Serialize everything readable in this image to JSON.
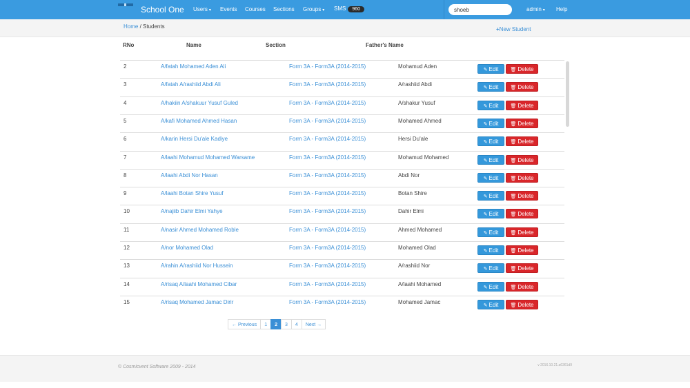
{
  "navbar": {
    "brand": "School One",
    "items": [
      {
        "label": "Users",
        "caret": true
      },
      {
        "label": "Events",
        "caret": false
      },
      {
        "label": "Courses",
        "caret": false
      },
      {
        "label": "Sections",
        "caret": false
      },
      {
        "label": "Groups",
        "caret": true
      },
      {
        "label": "SMS",
        "caret": false
      }
    ],
    "sms_count": "960",
    "search_value": "shoeb",
    "admin_label": "admin",
    "help_label": "Help",
    "caret_glyph": "▾"
  },
  "breadcrumb": {
    "home": "Home",
    "separator": " / ",
    "current": "Students"
  },
  "new_student_label": "New Student",
  "table": {
    "headers": {
      "rno": "RNo",
      "name": "Name",
      "section": "Section",
      "father": "Father's Name"
    },
    "edit_label": "Edit",
    "delete_label": "Delete",
    "rows": [
      {
        "rno": "2",
        "name": "A/fatah Mohamed Aden Ali",
        "section": "Form 3A - Form3A (2014-2015)",
        "father": "Mohamud Aden"
      },
      {
        "rno": "3",
        "name": "A/fatah A/rashiid Abdi Ali",
        "section": "Form 3A - Form3A (2014-2015)",
        "father": "A/rashiid Abdi"
      },
      {
        "rno": "4",
        "name": "A/hakiin A/shakuur Yusuf Guled",
        "section": "Form 3A - Form3A (2014-2015)",
        "father": "A/shakur Yusuf"
      },
      {
        "rno": "5",
        "name": "A/kafi Mohamed Ahmed Hasan",
        "section": "Form 3A - Form3A (2014-2015)",
        "father": "Mohamed Ahmed"
      },
      {
        "rno": "6",
        "name": "A/karin Hersi Du'ale Kadiye",
        "section": "Form 3A - Form3A (2014-2015)",
        "father": "Hersi Du'ale"
      },
      {
        "rno": "7",
        "name": "A/laahi Mohamud Mohamed Warsame",
        "section": "Form 3A - Form3A (2014-2015)",
        "father": "Mohamud Mohamed"
      },
      {
        "rno": "8",
        "name": "A/laahi Abdi Nor Hasan",
        "section": "Form 3A - Form3A (2014-2015)",
        "father": "Abdi Nor"
      },
      {
        "rno": "9",
        "name": "A/laahi Botan Shire Yusuf",
        "section": "Form 3A - Form3A (2014-2015)",
        "father": "Botan Shire"
      },
      {
        "rno": "10",
        "name": "A/najiib Dahir Elmi Yahye",
        "section": "Form 3A - Form3A (2014-2015)",
        "father": "Dahir Elmi"
      },
      {
        "rno": "11",
        "name": "A/nasir Ahmed Mohamed Roble",
        "section": "Form 3A - Form3A (2014-2015)",
        "father": "Ahmed Mohamed"
      },
      {
        "rno": "12",
        "name": "A/nor Mohamed Olad",
        "section": "Form 3A - Form3A (2014-2015)",
        "father": "Mohamed Olad"
      },
      {
        "rno": "13",
        "name": "A/rahin A/rashiid Nor Hussein",
        "section": "Form 3A - Form3A (2014-2015)",
        "father": "A/rashiid Nor"
      },
      {
        "rno": "14",
        "name": "A/risaq A/laahi Mohamed Cibar",
        "section": "Form 3A - Form3A (2014-2015)",
        "father": "A/laahi Mohamed"
      },
      {
        "rno": "15",
        "name": "A/risaq Mohamed Jamac Dirir",
        "section": "Form 3A - Form3A (2014-2015)",
        "father": "Mohamed Jamac"
      }
    ]
  },
  "pagination": {
    "prev": "← Previous",
    "pages": [
      "1",
      "2",
      "3",
      "4"
    ],
    "current": "2",
    "next": "Next →"
  },
  "footer": {
    "copyright": "© Cosmicvent Software 2009 - 2014",
    "version": "v 2016.10.21.a6361d9"
  },
  "colors": {
    "navbar": "#3a9be0",
    "link": "#3a8fd6",
    "edit": "#3498db",
    "delete": "#d9262a"
  },
  "icons": {
    "plus": "plus-icon",
    "edit": "edit-icon",
    "delete": "trash-icon"
  }
}
